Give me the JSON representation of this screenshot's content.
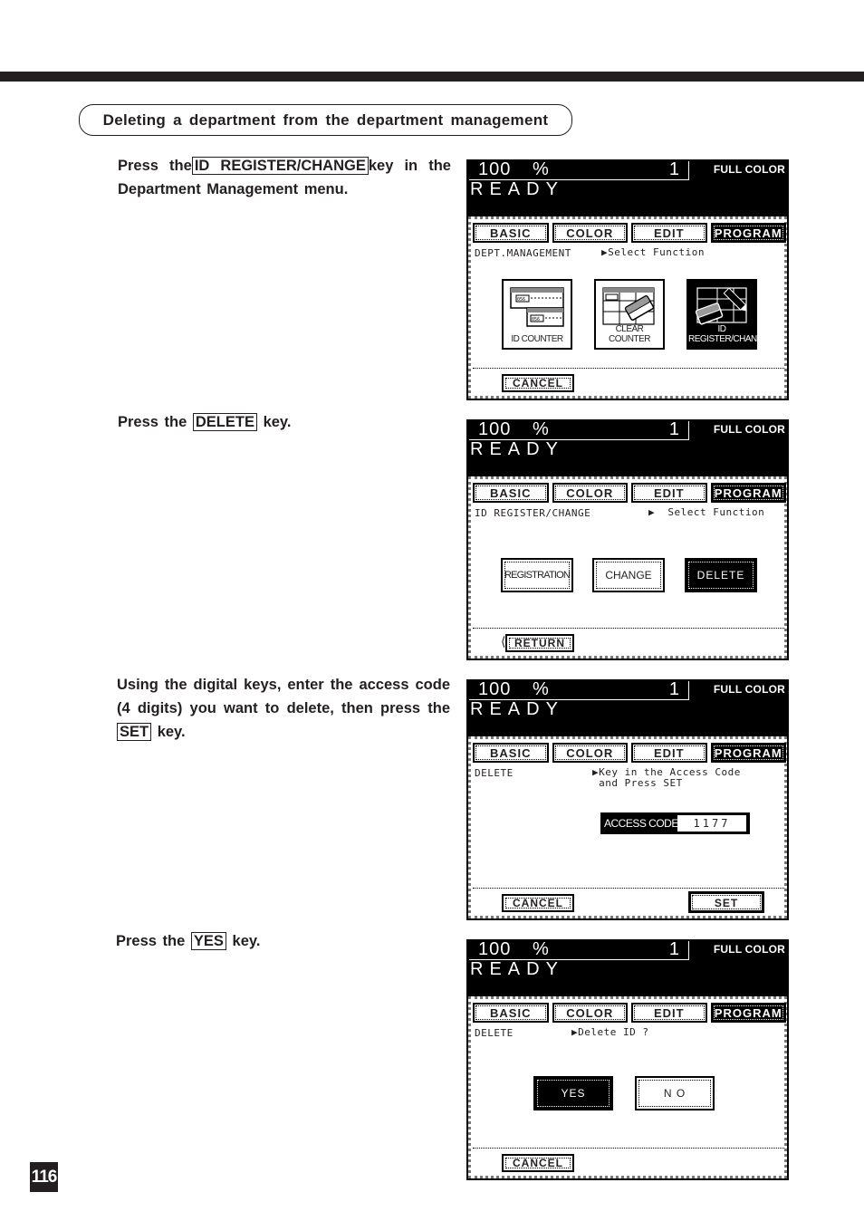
{
  "page": {
    "section_title": "Deleting a department from the department management",
    "page_number": "116"
  },
  "steps": [
    {
      "pre": "Press the",
      "key": "ID REGISTER/CHANGE",
      "post": "key in the Department Management menu."
    },
    {
      "pre": "Press the",
      "key": "DELETE",
      "post": "key."
    },
    {
      "pre": "Using the digital keys, enter the access code (4 digits) you want to delete, then press the",
      "key": "SET",
      "post": "key."
    },
    {
      "pre": "Press the",
      "key": "YES",
      "post": "key."
    }
  ],
  "screen_common": {
    "zoom_value": "100",
    "zoom_unit": "%",
    "copies": "1",
    "color_mode": "FULL COLOR",
    "status": "READY",
    "tabs": [
      "BASIC",
      "COLOR",
      "EDIT",
      "PROGRAM"
    ],
    "active_tab": "PROGRAM"
  },
  "screens": [
    {
      "menu": "DEPT.MANAGEMENT",
      "prompt": "▶Select Function",
      "icon_buttons": [
        {
          "label": "ID COUNTER",
          "icon": "id-counter-icon"
        },
        {
          "label": "CLEAR COUNTER",
          "icon": "clear-counter-icon"
        },
        {
          "label": "ID REGISTER/CHANGE",
          "icon": "id-register-change-icon",
          "selected": true
        }
      ],
      "bottom_left": "CANCEL"
    },
    {
      "menu": "ID REGISTER/CHANGE",
      "prompt": "▶  Select Function",
      "buttons": [
        "REGISTRATION",
        "CHANGE",
        "DELETE"
      ],
      "selected": "DELETE",
      "bottom_left": "RETURN"
    },
    {
      "menu": "DELETE",
      "prompt": "▶Key in the Access Code\n and Press SET",
      "access_code_label": "ACCESS CODE",
      "access_code_value": "1177",
      "bottom_left": "CANCEL",
      "bottom_right": "SET"
    },
    {
      "menu": "DELETE",
      "prompt": "▶Delete ID ?",
      "buttons": [
        "YES",
        "N O"
      ],
      "selected": "YES",
      "bottom_left": "CANCEL"
    }
  ]
}
